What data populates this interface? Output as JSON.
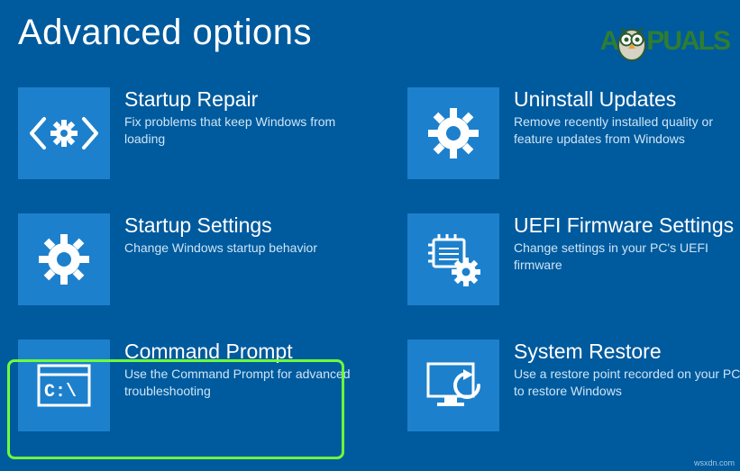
{
  "page": {
    "title": "Advanced options"
  },
  "tiles": {
    "startup_repair": {
      "title": "Startup Repair",
      "desc": "Fix problems that keep Windows from loading"
    },
    "uninstall_updates": {
      "title": "Uninstall Updates",
      "desc": "Remove recently installed quality or feature updates from Windows"
    },
    "startup_settings": {
      "title": "Startup Settings",
      "desc": "Change Windows startup behavior"
    },
    "uefi": {
      "title": "UEFI Firmware Settings",
      "desc": "Change settings in your PC's UEFI firmware"
    },
    "command_prompt": {
      "title": "Command Prompt",
      "desc": "Use the Command Prompt for advanced troubleshooting"
    },
    "system_restore": {
      "title": "System Restore",
      "desc": "Use a restore point recorded on your PC to restore Windows"
    }
  },
  "watermark": {
    "left": "A",
    "right": "PUALS"
  },
  "credit": "wsxdn.com"
}
